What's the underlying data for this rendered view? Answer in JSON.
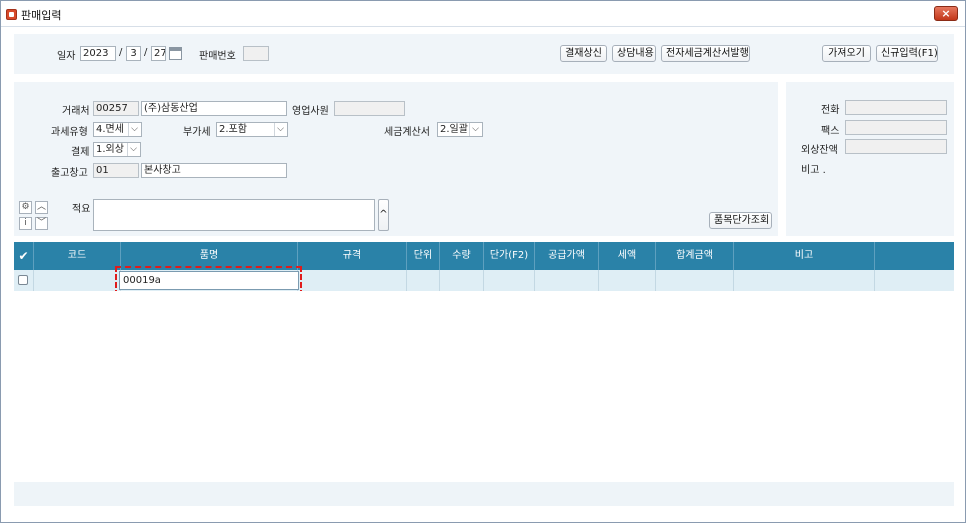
{
  "window": {
    "title": "판매입력",
    "close_label": "×"
  },
  "top": {
    "date_label": "일자",
    "year": "2023",
    "month": "3",
    "day": "27",
    "slash": "/",
    "sale_no_label": "판매번호",
    "sale_no": "",
    "buttons": {
      "approval": "결재상신",
      "consult": "상담내용",
      "e_tax_invoice": "전자세금계산서발행",
      "import": "가져오기",
      "new_entry": "신규입력(F1)"
    }
  },
  "form": {
    "customer_label": "거래처",
    "customer_code": "00257",
    "customer_name": "(주)삼동산업",
    "sales_rep_label": "영업사원",
    "sales_rep": "",
    "tax_type_label": "과세유형",
    "tax_type": "4.면세",
    "vat_label": "부가세",
    "vat": "2.포함",
    "tax_invoice_label": "세금계산서",
    "tax_invoice": "2.일괄",
    "payment_label": "결제",
    "payment": "1.외상",
    "warehouse_label": "출고창고",
    "warehouse_code": "01",
    "warehouse_name": "본사창고",
    "memo_label": "적요",
    "memo": "",
    "memo_expand": "^",
    "item_price_btn": "품목단가조회"
  },
  "side": {
    "phone_label": "전화",
    "fax_label": "팩스",
    "credit_label": "외상잔액",
    "note_label": "비고 ."
  },
  "grid": {
    "check_header": "✔",
    "columns": [
      "코드",
      "품명",
      "규격",
      "단위",
      "수량",
      "단가(F2)",
      "공급가액",
      "세액",
      "합계금액",
      "비고"
    ],
    "row1": {
      "item_name": "00019a"
    }
  },
  "icons": {
    "gear": "gear-icon",
    "info": "info-icon",
    "up": "chevron-up-icon",
    "down": "chevron-down-icon"
  },
  "colors": {
    "grid_header": "#2a82a8",
    "highlight": "#e01b1b",
    "panel": "#f0f5f9"
  }
}
